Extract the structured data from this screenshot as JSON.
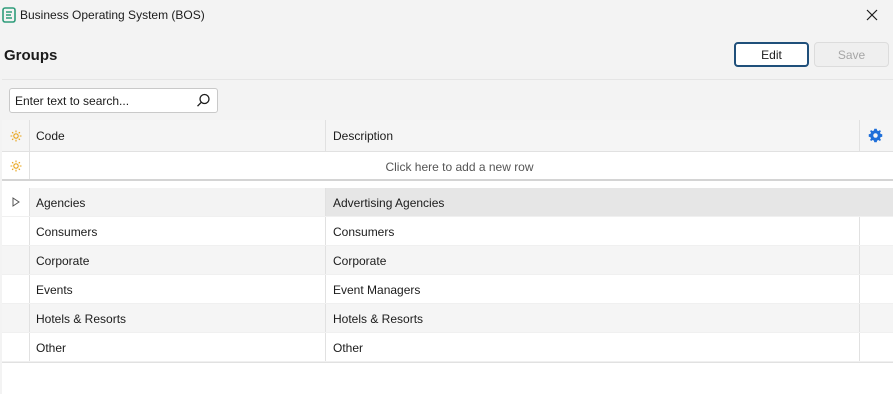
{
  "window": {
    "title": "Business Operating System (BOS)"
  },
  "page": {
    "title": "Groups"
  },
  "toolbar": {
    "edit_label": "Edit",
    "save_label": "Save"
  },
  "search": {
    "placeholder": "Enter text to search..."
  },
  "grid": {
    "columns": [
      {
        "key": "code",
        "label": "Code"
      },
      {
        "key": "description",
        "label": "Description"
      }
    ],
    "new_row_text": "Click here to add a new row",
    "rows": [
      {
        "code": "Agencies",
        "description": "Advertising Agencies",
        "selected": true
      },
      {
        "code": "Consumers",
        "description": "Consumers"
      },
      {
        "code": "Corporate",
        "description": "Corporate"
      },
      {
        "code": "Events",
        "description": "Event Managers"
      },
      {
        "code": "Hotels & Resorts",
        "description": "Hotels & Resorts"
      },
      {
        "code": "Other",
        "description": "Other"
      }
    ]
  },
  "colors": {
    "accent": "#1f4f7a",
    "gear": "#1e6fd9",
    "sun": "#e8a317",
    "app_icon": "#2e9c7a"
  },
  "icons": {
    "app": "bos-app-icon",
    "close": "close-icon",
    "search": "search-icon",
    "settings": "gear-icon",
    "header_indicator": "sun-icon",
    "row_pointer": "triangle-right-icon"
  }
}
